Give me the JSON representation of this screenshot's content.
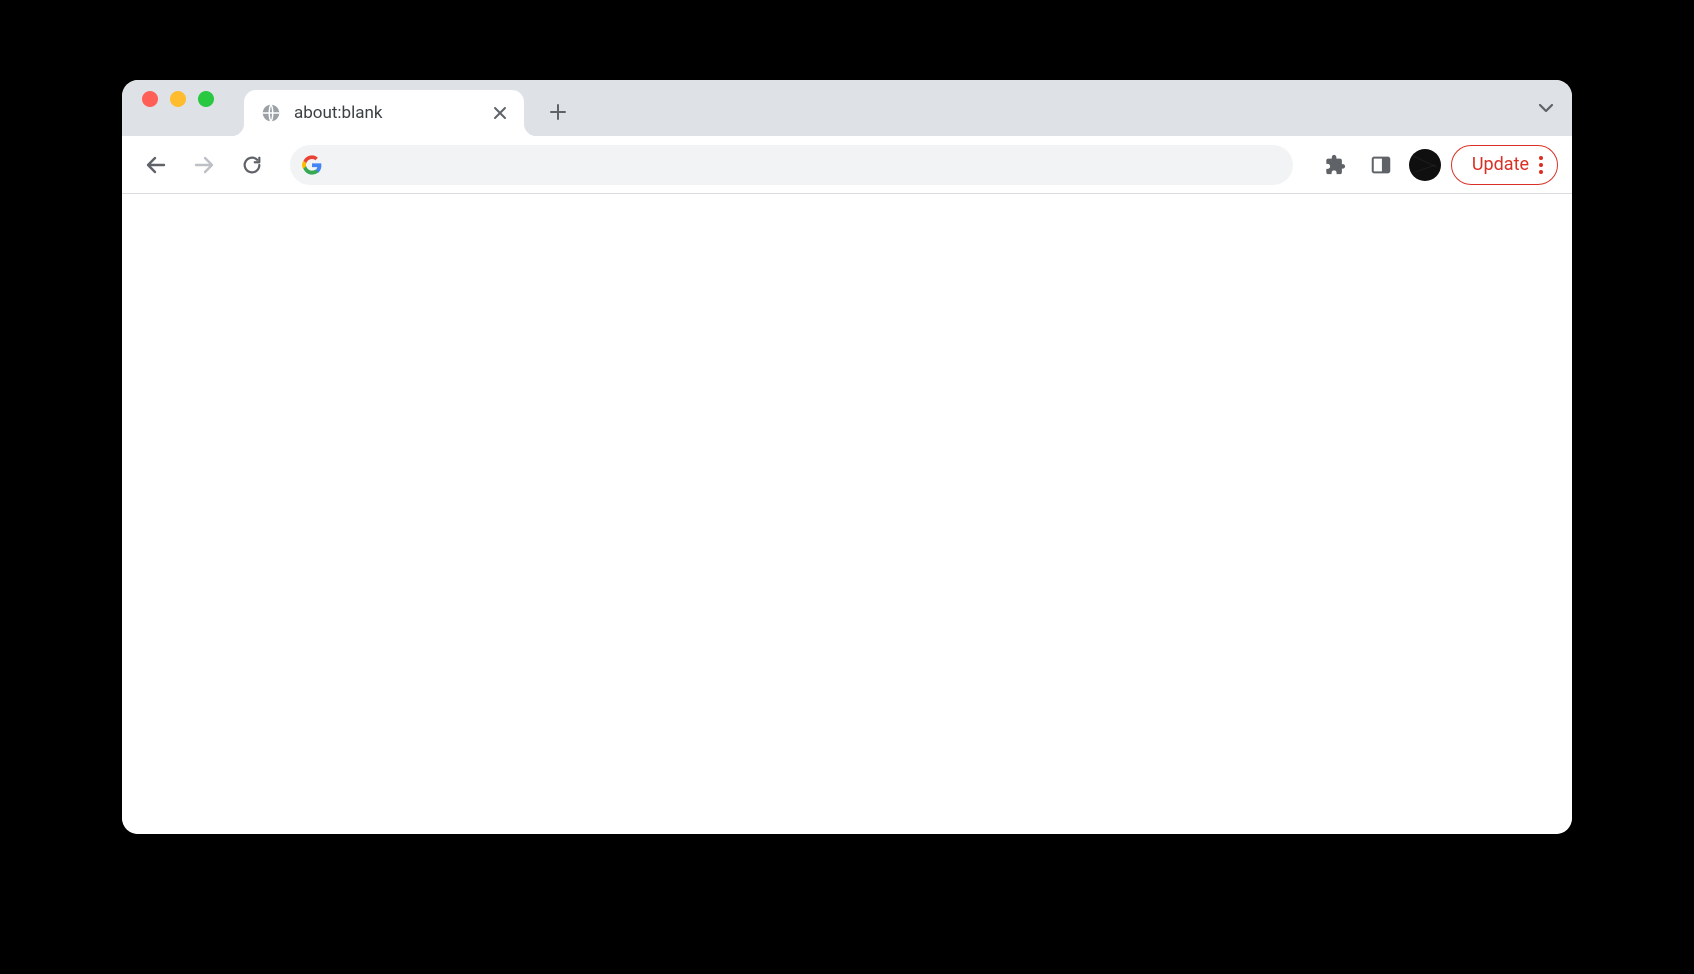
{
  "tab": {
    "title": "about:blank"
  },
  "omnibox": {
    "value": "",
    "placeholder": ""
  },
  "update": {
    "label": "Update"
  },
  "colors": {
    "accent_update": "#d93025",
    "tabstrip_bg": "#dee1e6"
  }
}
